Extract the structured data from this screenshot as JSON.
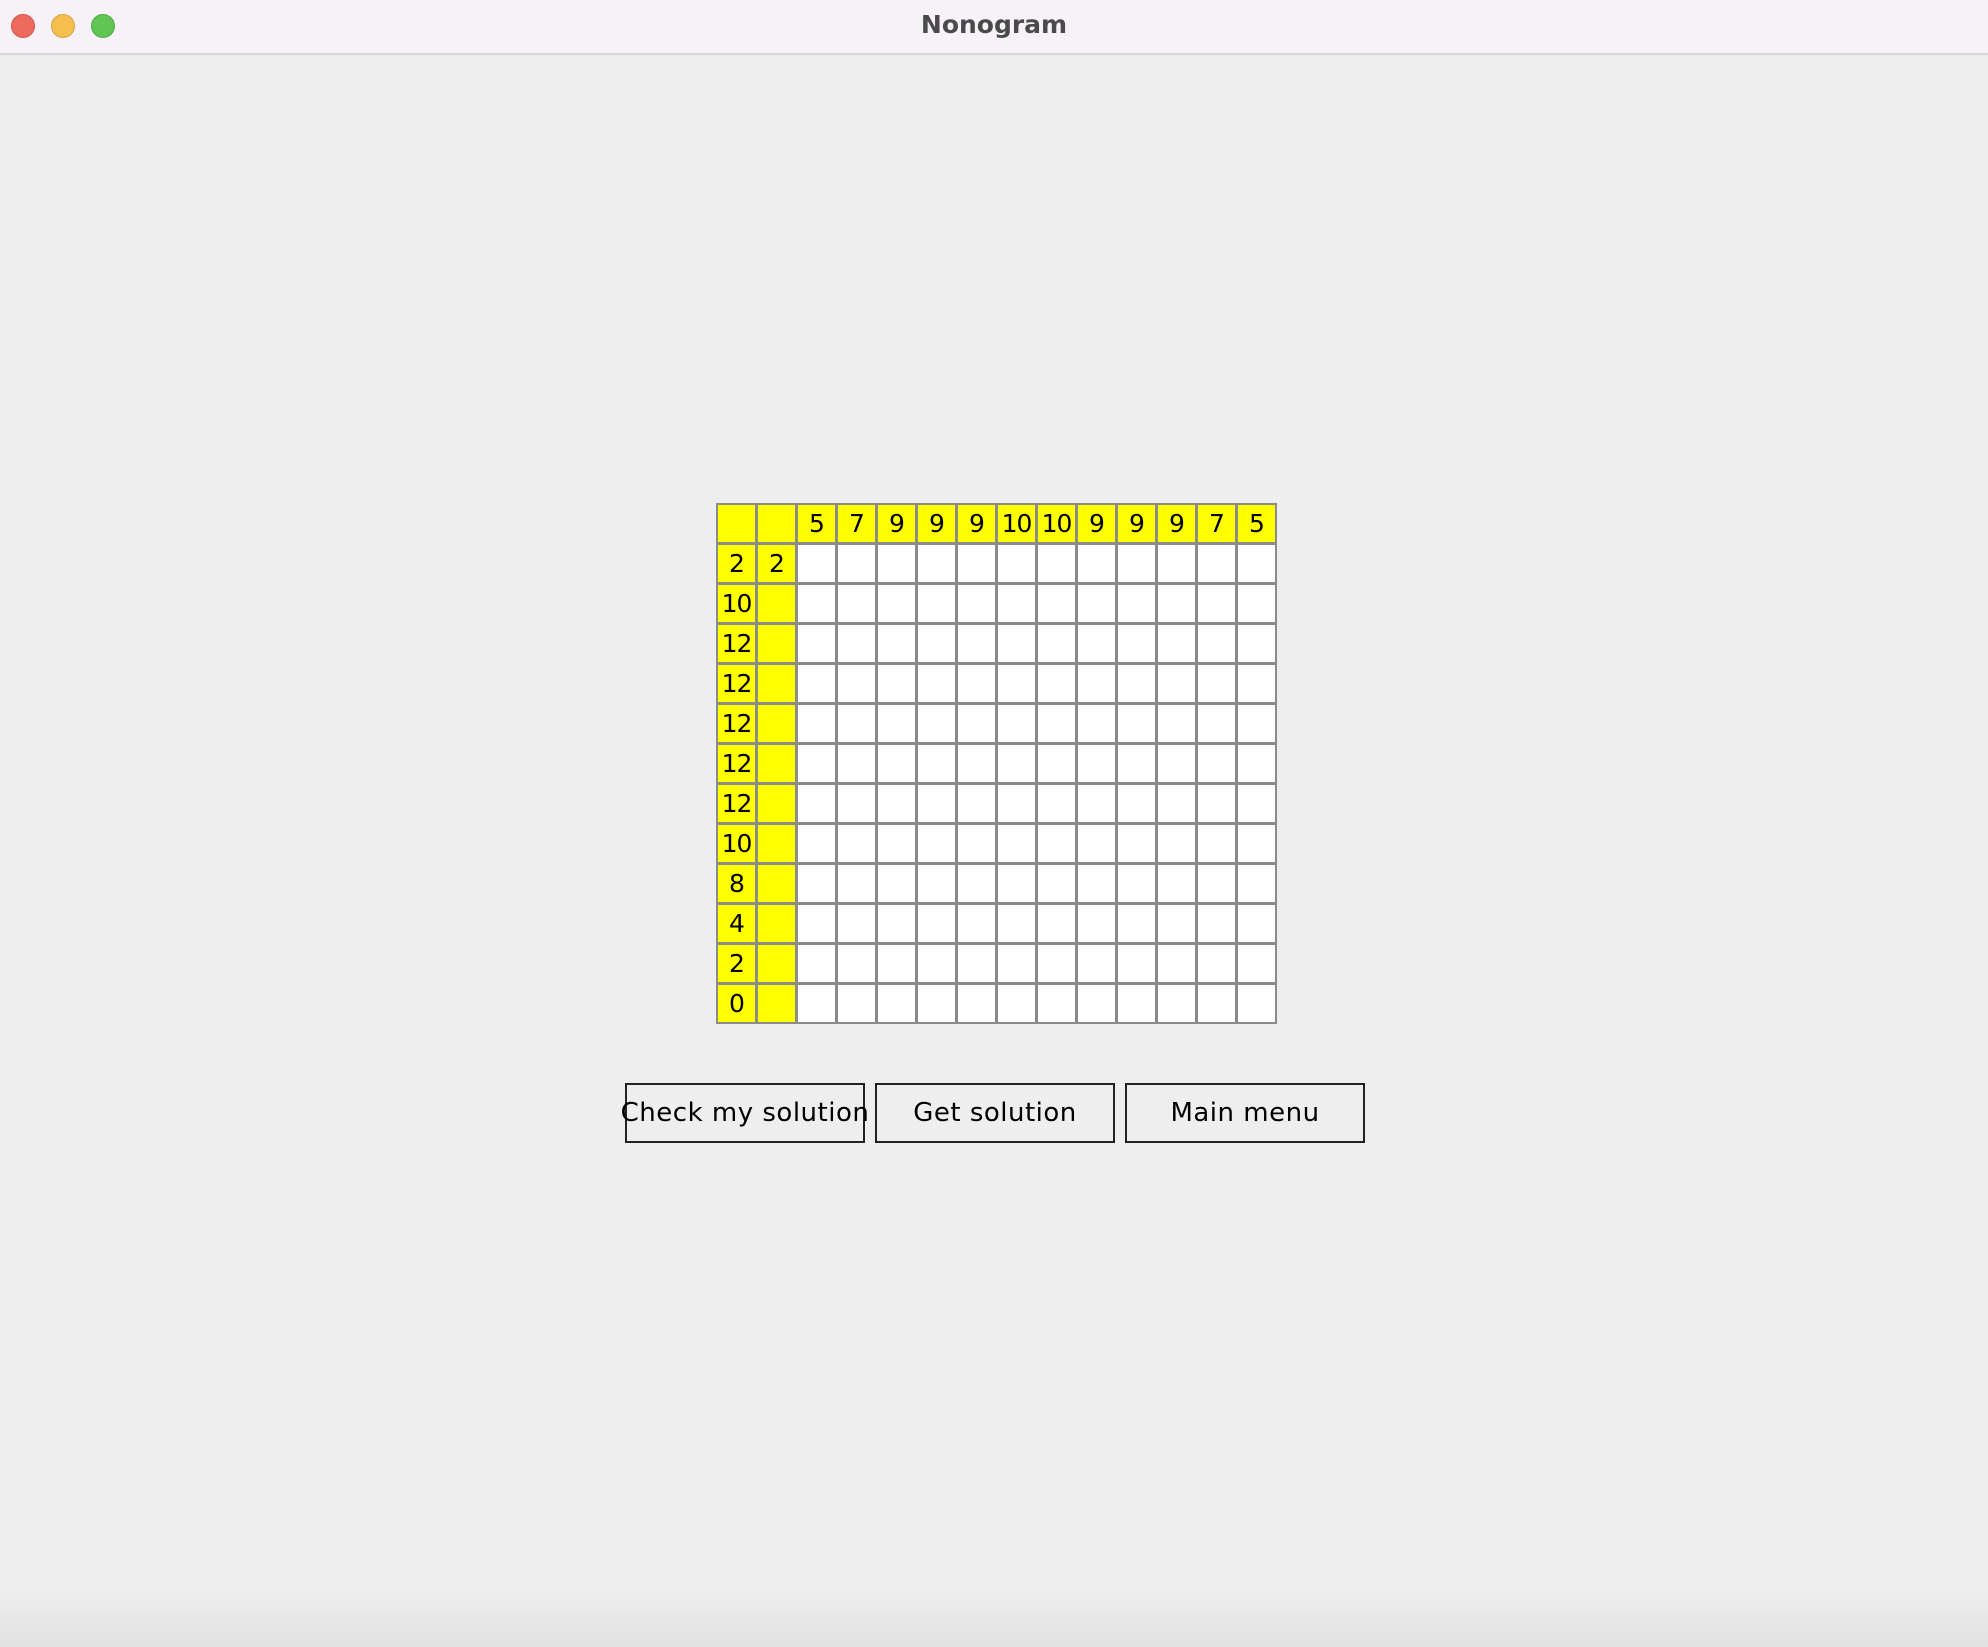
{
  "window": {
    "title": "Nonogram"
  },
  "nonogram": {
    "column_clues": [
      "5",
      "7",
      "9",
      "9",
      "9",
      "10",
      "10",
      "9",
      "9",
      "9",
      "7",
      "5"
    ],
    "row_clues": [
      [
        "2",
        "2"
      ],
      [
        "10",
        ""
      ],
      [
        "12",
        ""
      ],
      [
        "12",
        ""
      ],
      [
        "12",
        ""
      ],
      [
        "12",
        ""
      ],
      [
        "12",
        ""
      ],
      [
        "10",
        ""
      ],
      [
        "8",
        ""
      ],
      [
        "4",
        ""
      ],
      [
        "2",
        ""
      ],
      [
        "0",
        ""
      ]
    ],
    "filled_cells": [],
    "clue_color": "#ffff00",
    "empty_cell_color": "#ffffff",
    "border_color": "#8b8b8b"
  },
  "buttons": {
    "check": "Check my solution",
    "solution": "Get solution",
    "menu": "Main menu"
  }
}
